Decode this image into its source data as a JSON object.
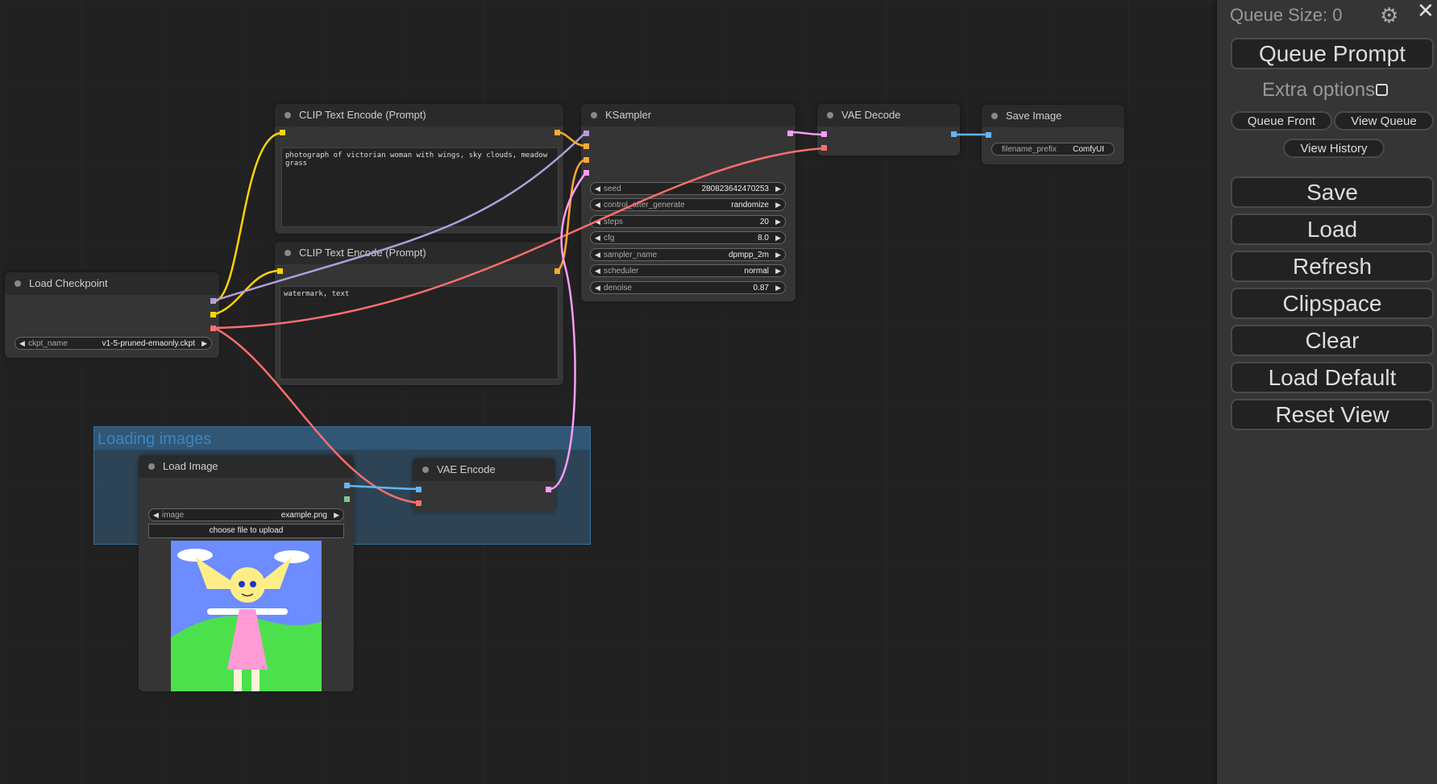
{
  "colors": {
    "background": "#212121",
    "node": "#353535",
    "clip": "#ffd500",
    "model": "#b39ddb",
    "vae": "#ff6e6e",
    "conditioning": "#ffa931",
    "latent": "#ff9cf9",
    "image": "#64b5f6",
    "mask": "#81c784"
  },
  "group": {
    "title": "Loading images"
  },
  "nodes": {
    "clip1": {
      "title": "CLIP Text Encode (Prompt)",
      "text": "photograph of victorian woman with wings, sky clouds, meadow grass"
    },
    "clip2": {
      "title": "CLIP Text Encode (Prompt)",
      "text": "watermark, text"
    },
    "ksampler": {
      "title": "KSampler",
      "widgets": [
        {
          "label": "seed",
          "value": "280823642470253"
        },
        {
          "label": "control_after_generate",
          "value": "randomize"
        },
        {
          "label": "steps",
          "value": "20"
        },
        {
          "label": "cfg",
          "value": "8.0"
        },
        {
          "label": "sampler_name",
          "value": "dpmpp_2m"
        },
        {
          "label": "scheduler",
          "value": "normal"
        },
        {
          "label": "denoise",
          "value": "0.87"
        }
      ]
    },
    "vaedecode": {
      "title": "VAE Decode"
    },
    "saveimage": {
      "title": "Save Image",
      "widget": {
        "label": "filename_prefix",
        "value": "ComfyUI"
      }
    },
    "checkpoint": {
      "title": "Load Checkpoint",
      "widget": {
        "label": "ckpt_name",
        "value": "v1-5-pruned-emaonly.ckpt"
      }
    },
    "loadimage": {
      "title": "Load Image",
      "widget": {
        "label": "image",
        "value": "example.png"
      },
      "upload": "choose file to upload"
    },
    "vaeencode": {
      "title": "VAE Encode"
    }
  },
  "menu": {
    "queue_size": "Queue Size: 0",
    "queue_prompt": "Queue Prompt",
    "extra_options": "Extra options",
    "queue_front": "Queue Front",
    "view_queue": "View Queue",
    "view_history": "View History",
    "buttons": [
      "Save",
      "Load",
      "Refresh",
      "Clipspace",
      "Clear",
      "Load Default",
      "Reset View"
    ]
  }
}
